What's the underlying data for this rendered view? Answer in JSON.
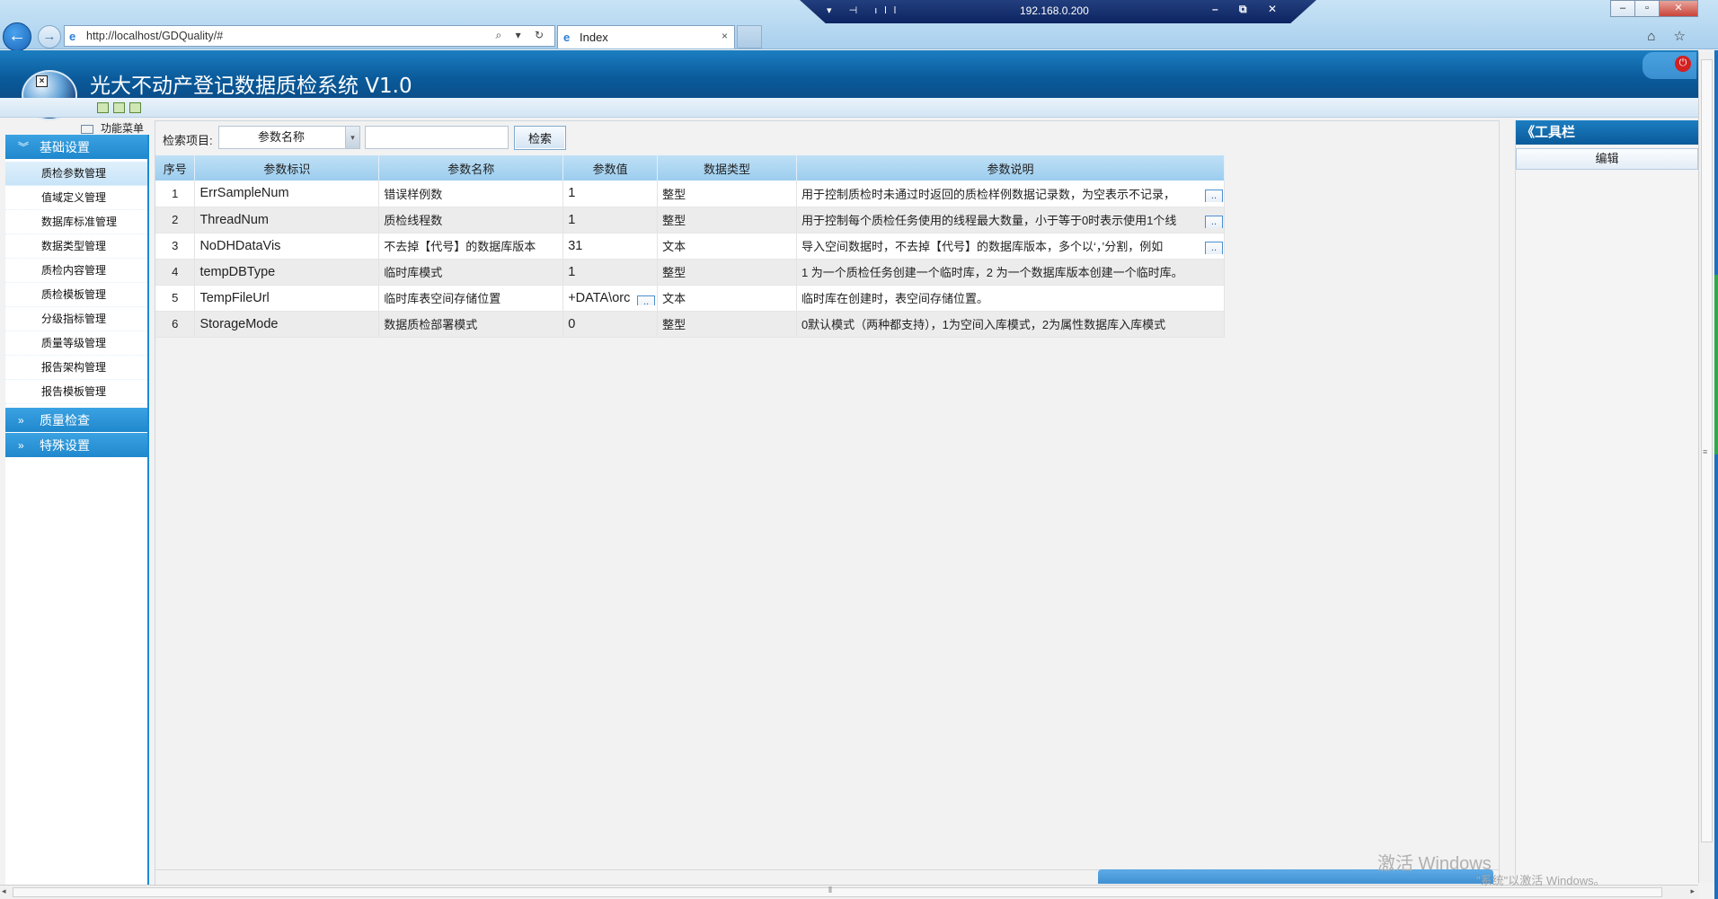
{
  "browser": {
    "url": "http://localhost/GDQuality/#",
    "tab_label": "Index",
    "tab_close": "×",
    "remote_ip": "192.168.0.200",
    "remote_left_icons": "▾ ⊣ ıll",
    "remote_right_icons": "– ⧉ ✕",
    "window_buttons": [
      "–",
      "▫",
      "✕"
    ],
    "address_tools": "⌕ ▾ ↻",
    "right_icons": "⌂ ☆",
    "back": "←",
    "forward": "→",
    "ie_glyph": "e"
  },
  "app": {
    "title": "光大不动产登记数据质检系统 V1.0",
    "logo_mark": "×",
    "power": "⏻"
  },
  "func_menu": {
    "label": "功能菜单"
  },
  "sidebar": {
    "groups": [
      {
        "label": "基础设置",
        "chevron": "︾",
        "items": [
          {
            "label": "质检参数管理",
            "active": true
          },
          {
            "label": "值域定义管理"
          },
          {
            "label": "数据库标准管理"
          },
          {
            "label": "数据类型管理"
          },
          {
            "label": "质检内容管理"
          },
          {
            "label": "质检模板管理"
          },
          {
            "label": "分级指标管理"
          },
          {
            "label": "质量等级管理"
          },
          {
            "label": "报告架构管理"
          },
          {
            "label": "报告模板管理"
          }
        ]
      },
      {
        "label": "质量检查",
        "chevron": "»"
      },
      {
        "label": "特殊设置",
        "chevron": "»"
      }
    ]
  },
  "search": {
    "label": "检索项目:",
    "selected": "参数名称",
    "dropdown_glyph": "▾",
    "input_value": "",
    "button": "检索"
  },
  "table": {
    "headers": [
      "序号",
      "参数标识",
      "参数名称",
      "参数值",
      "数据类型",
      "参数说明"
    ],
    "ellipsis": "..",
    "rows": [
      {
        "no": "1",
        "id": "ErrSampleNum",
        "name": "错误样例数",
        "value": "1",
        "type": "整型",
        "desc": "用于控制质检时未通过时返回的质检样例数据记录数，为空表示不记录，"
      },
      {
        "no": "2",
        "id": "ThreadNum",
        "name": "质检线程数",
        "value": "1",
        "type": "整型",
        "desc": "用于控制每个质检任务使用的线程最大数量，小于等于0时表示使用1个线"
      },
      {
        "no": "3",
        "id": "NoDHDataVis",
        "name": "不去掉【代号】的数据库版本",
        "value": "31",
        "type": "文本",
        "desc": "导入空间数据时，不去掉【代号】的数据库版本，多个以‘，’分割，例如"
      },
      {
        "no": "4",
        "id": "tempDBType",
        "name": "临时库模式",
        "value": "1",
        "type": "整型",
        "desc": "1 为一个质检任务创建一个临时库，2 为一个数据库版本创建一个临时库。"
      },
      {
        "no": "5",
        "id": "TempFileUrl",
        "name": "临时库表空间存储位置",
        "value": "+DATA\\orc",
        "type": "文本",
        "desc": "临时库在创建时，表空间存储位置。"
      },
      {
        "no": "6",
        "id": "StorageMode",
        "name": "数据质检部署模式",
        "value": "0",
        "type": "整型",
        "desc": "0默认模式（两种都支持），1为空间入库模式，2为属性数据库入库模式"
      }
    ]
  },
  "toolbox": {
    "title": "《工具栏",
    "edit_button": "编辑"
  },
  "watermark": {
    "line1": "激活 Windows",
    "line2": "\"系统\"以激活 Windows。"
  },
  "scrollbar": {
    "grip": "≡",
    "grip_h": "⦀",
    "arrow_left": "◂",
    "arrow_right": "▸"
  }
}
